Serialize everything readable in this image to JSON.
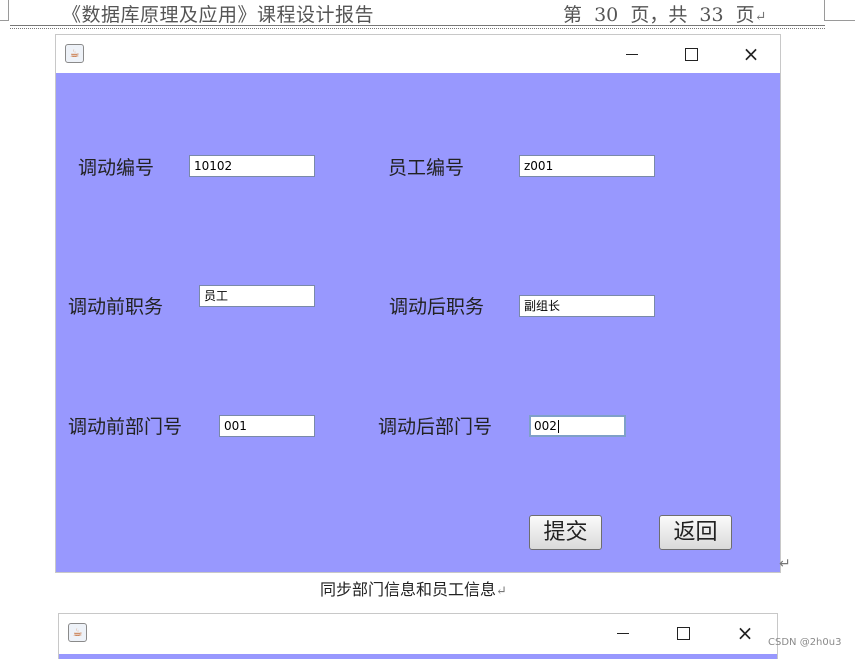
{
  "doc_header": {
    "title": "《数据库原理及应用》课程设计报告",
    "page_info": "第  30  页，共  33  页",
    "para_mark": "↵"
  },
  "window1": {
    "icon": "java-cup-icon",
    "controls": {
      "minimize": "minimize-icon",
      "maximize": "maximize-icon",
      "close": "×"
    },
    "form": {
      "transfer_id": {
        "label": "调动编号",
        "value": "10102"
      },
      "employee_id": {
        "label": "员工编号",
        "value": "z001"
      },
      "position_before": {
        "label": "调动前职务",
        "value": "员工"
      },
      "position_after": {
        "label": "调动后职务",
        "value": "副组长"
      },
      "dept_before": {
        "label": "调动前部门号",
        "value": "001"
      },
      "dept_after": {
        "label": "调动后部门号",
        "value": "002"
      }
    },
    "buttons": {
      "submit": "提交",
      "back": "返回"
    },
    "background": "#9898fe"
  },
  "after_window_mark": "↵",
  "caption": "同步部门信息和员工信息",
  "caption_mark": "↵",
  "window2": {
    "icon": "java-cup-icon",
    "controls": {
      "minimize": "minimize-icon",
      "maximize": "maximize-icon",
      "close": "×"
    }
  },
  "watermark": "CSDN @2h0u3"
}
